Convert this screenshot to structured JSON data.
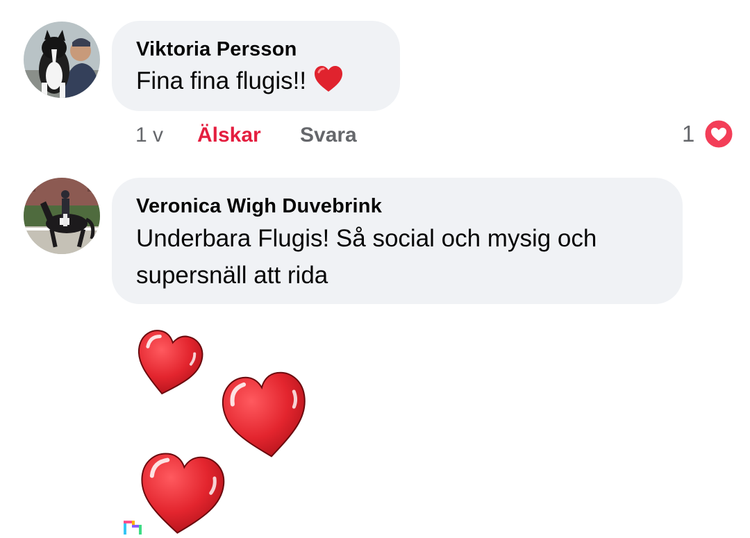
{
  "comments": [
    {
      "author": "Viktoria Persson",
      "text": "Fina fina flugis!!",
      "emoji": "red-heart",
      "time": "1 v",
      "love_label": "Älskar",
      "reply_label": "Svara",
      "reaction_count": "1"
    },
    {
      "author": "Veronica Wigh Duvebrink",
      "text_line1": "Underbara Flugis! Så social och mysig och",
      "text_line2": "supersnäll att rida"
    }
  ],
  "colors": {
    "bubble": "#f0f2f5",
    "love": "#e41e3f",
    "meta": "#65676b",
    "heart_sticker": "#e0232e"
  }
}
